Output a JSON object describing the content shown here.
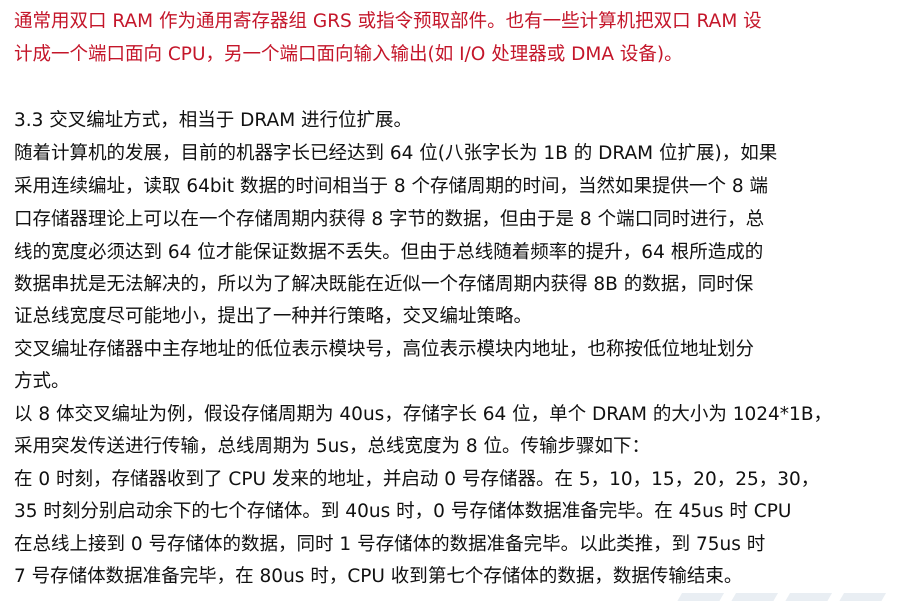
{
  "intro": {
    "lines": [
      "通常用双口 RAM 作为通用寄存器组 GRS 或指令预取部件。也有一些计算机把双口 RAM 设",
      "计成一个端口面向 CPU，另一个端口面向输入输出(如 I/O 处理器或 DMA 设备)。"
    ],
    "text_color": "#c4162a"
  },
  "section": {
    "heading": "3.3 交叉编址方式，相当于 DRAM 进行位扩展。",
    "lines": [
      "随着计算机的发展，目前的机器字长已经达到 64 位(八张字长为 1B 的 DRAM 位扩展)，如果",
      "采用连续编址，读取 64bit 数据的时间相当于 8 个存储周期的时间，当然如果提供一个 8 端",
      "口存储器理论上可以在一个存储周期内获得 8 字节的数据，但由于是 8 个端口同时进行，总",
      "线的宽度必须达到 64 位才能保证数据不丢失。但由于总线随着频率的提升，64 根所造成的",
      "数据串扰是无法解决的，所以为了解决既能在近似一个存储周期内获得 8B 的数据，同时保",
      "证总线宽度尽可能地小，提出了一种并行策略，交叉编址策略。",
      "交叉编址存储器中主存地址的低位表示模块号，高位表示模块内地址，也称按低位地址划分",
      "方式。",
      "以 8 体交叉编址为例，假设存储周期为 40us，存储字长 64 位，单个 DRAM 的大小为 1024*1B，",
      "采用突发传送进行传输，总线周期为 5us，总线宽度为 8 位。传输步骤如下：",
      "在 0 时刻，存储器收到了 CPU 发来的地址，并启动 0 号存储器。在 5，10，15，20，25，30，",
      "35 时刻分别启动余下的七个存储体。到 40us 时，0 号存储体数据准备完毕。在 45us 时 CPU",
      "在总线上接到 0 号存储体的数据，同时 1 号存储体的数据准备完毕。以此类推，到 75us 时",
      "7 号存储体数据准备完毕，在 80us 时，CPU 收到第七个存储体的数据，数据传输结束。"
    ],
    "text_color": "#111111"
  }
}
